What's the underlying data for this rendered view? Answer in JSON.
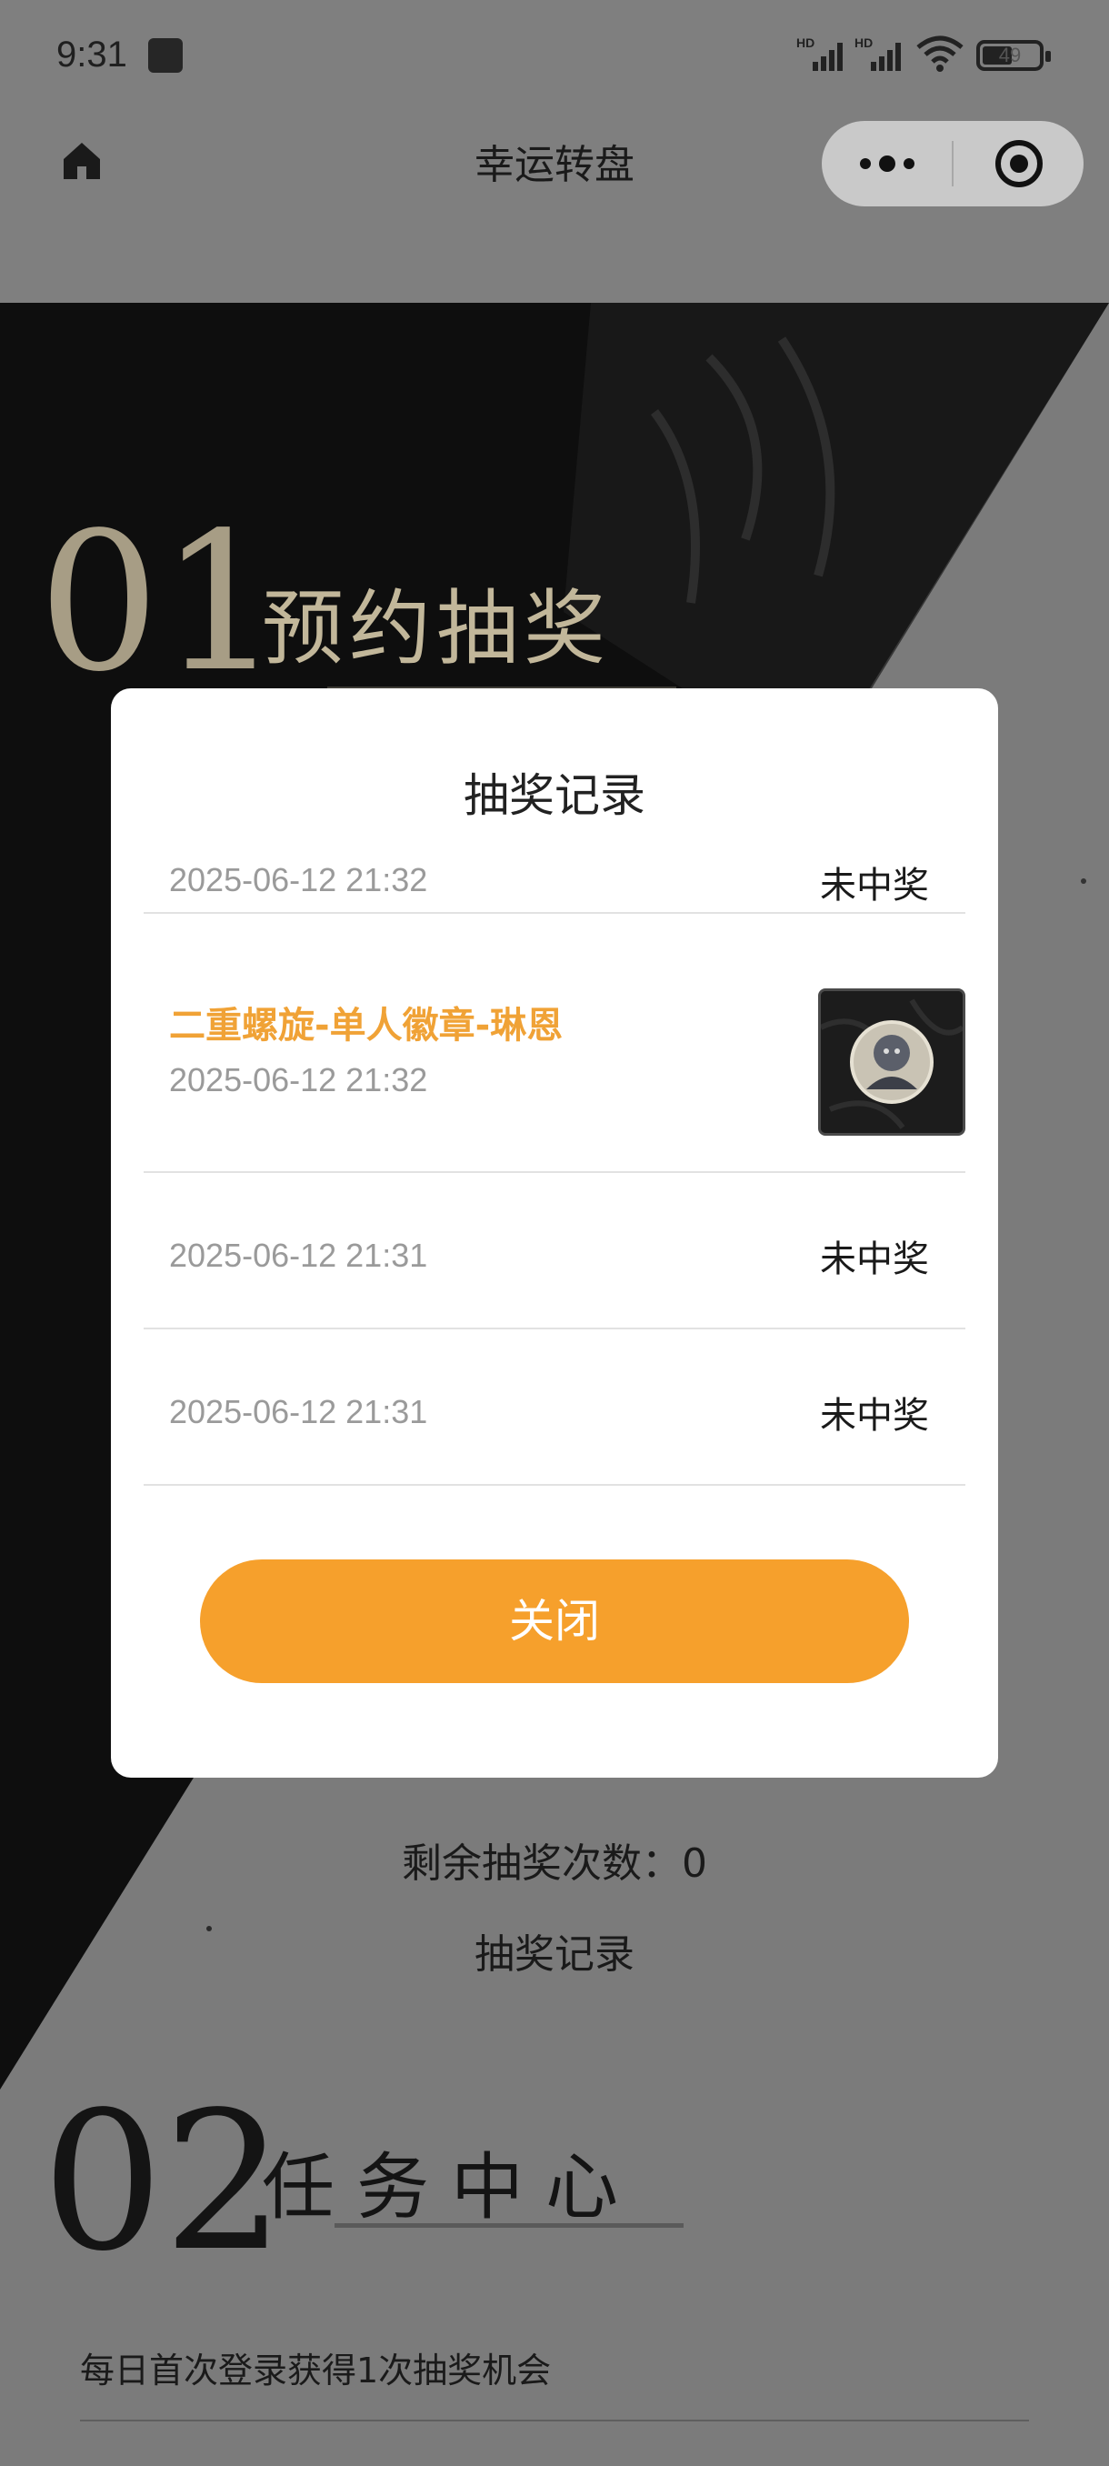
{
  "status_bar": {
    "time": "9:31",
    "battery_level": "49",
    "icons": [
      "app-notification-icon",
      "hd-signal-icon",
      "hd-signal-icon",
      "wifi-icon",
      "battery-icon"
    ]
  },
  "nav": {
    "title": "幸运转盘",
    "icons": [
      "home-icon",
      "more-icon",
      "close-miniprogram-icon"
    ]
  },
  "page": {
    "section1": {
      "number": "01",
      "title": "预约抽奖"
    },
    "remaining_draws": "剩余抽奖次数：0",
    "record_link": "抽奖记录",
    "section2": {
      "number": "02",
      "title": "任务中心"
    },
    "tasks": [
      "每日首次登录获得1次抽奖机会"
    ]
  },
  "modal": {
    "title": "抽奖记录",
    "records": [
      {
        "date": "2025-06-12 21:32",
        "status": "未中奖"
      },
      {
        "prize": "二重螺旋-单人徽章-琳恩",
        "date": "2025-06-12 21:32",
        "thumb": "badge-image"
      },
      {
        "date": "2025-06-12 21:31",
        "status": "未中奖"
      },
      {
        "date": "2025-06-12 21:31",
        "status": "未中奖"
      }
    ],
    "close_label": "关闭"
  },
  "colors": {
    "accent": "#f6a02c",
    "prize_text": "#f0a236",
    "overlay": "#7f7f7f"
  }
}
